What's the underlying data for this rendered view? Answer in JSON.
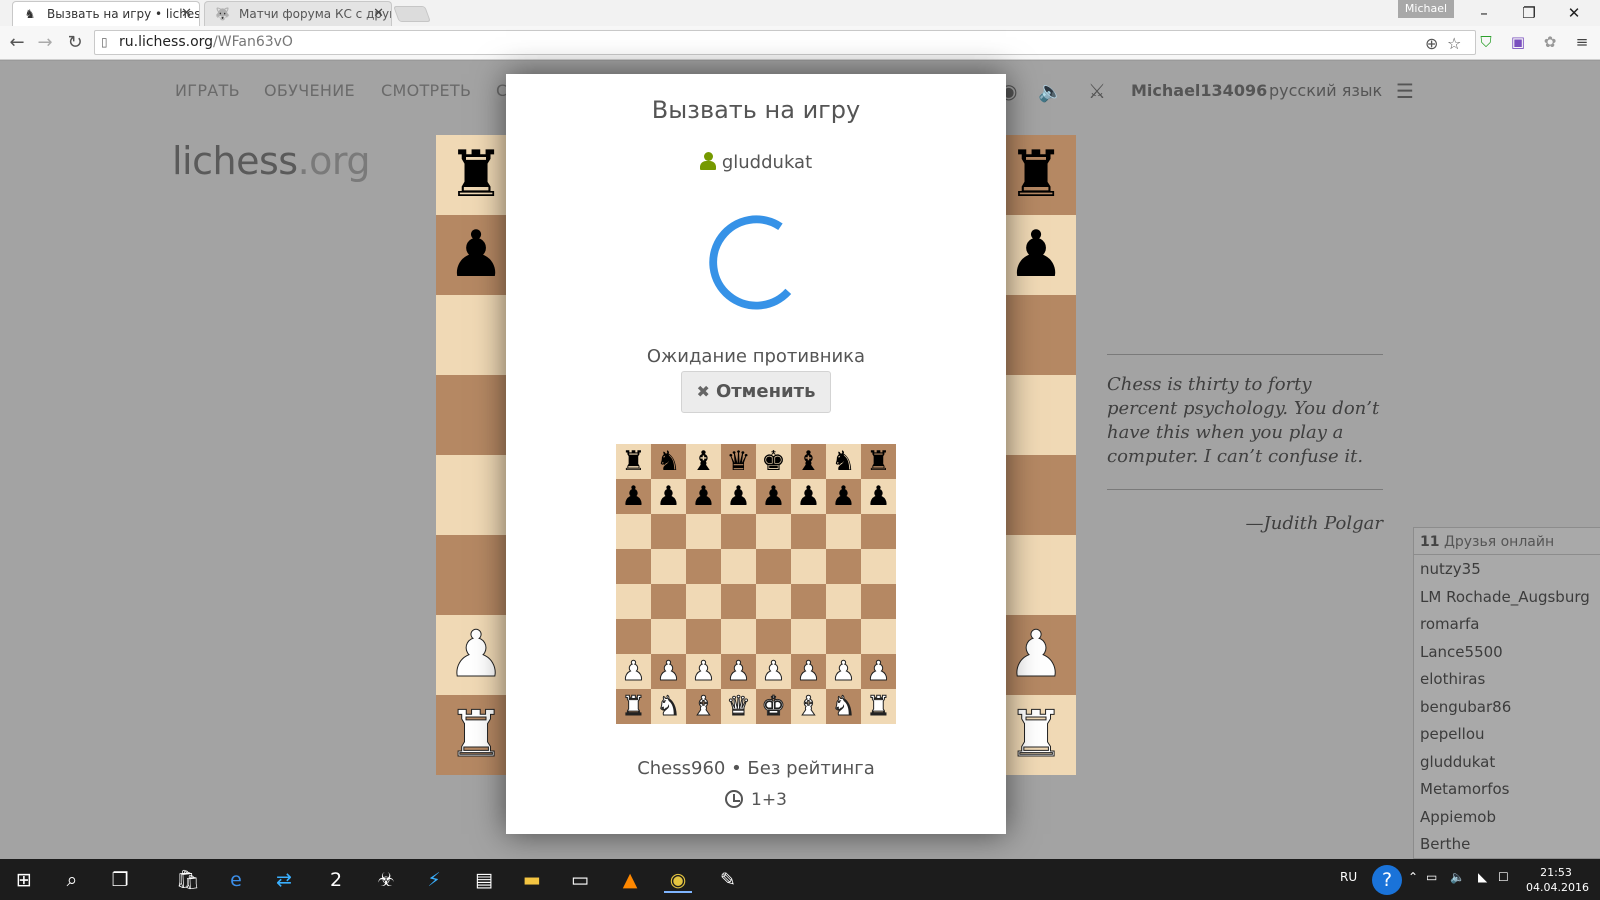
{
  "browser": {
    "tabs": [
      {
        "title": "Вызвать на игру • lichess",
        "favicon": "lichess-knight-icon",
        "active": true
      },
      {
        "title": "Матчи форума КС с друг",
        "favicon": "wolf-icon",
        "active": false
      }
    ],
    "profile_name": "Michael",
    "url_host": "ru.lichess.org",
    "url_path": "/WFan63vO"
  },
  "nav": {
    "items": [
      "ИГРАТЬ",
      "ОБУЧЕНИЕ",
      "СМОТРЕТЬ",
      "С"
    ],
    "username": "Michael134096",
    "language": "русский язык"
  },
  "logo": {
    "main": "lichess",
    "tld": ".org"
  },
  "quote": {
    "text": "Chess is thirty to forty percent psychology. You don’t have this when you play a computer. I can’t confuse it.",
    "author": "—Judith Polgar"
  },
  "friends": {
    "count": "11",
    "label": "Друзья онлайн",
    "list": [
      "nutzy35",
      "LM Rochade_Augsburg",
      "romarfa",
      "Lance5500",
      "elothiras",
      "bengubar86",
      "pepellou",
      "gluddukat",
      "Metamorfos",
      "Appiemob",
      "Berthe"
    ]
  },
  "modal": {
    "title": "Вызвать на игру",
    "opponent": "gluddukat",
    "waiting": "Ожидание противника",
    "cancel": "Отменить",
    "variant": "Chess960 • Без рейтинга",
    "time_control": "1+3",
    "board": {
      "ranks": [
        "rnbqkbnr",
        "pppppppp",
        "8",
        "8",
        "8",
        "8",
        "PPPPPPPP",
        "RNBQKBNR"
      ]
    }
  },
  "taskbar": {
    "lang": "RU",
    "time": "21:53",
    "date": "04.04.2016"
  },
  "colors": {
    "light_square": "#f0d9b5",
    "dark_square": "#b58863",
    "spinner": "#3692e7",
    "user_icon": "#759900"
  }
}
